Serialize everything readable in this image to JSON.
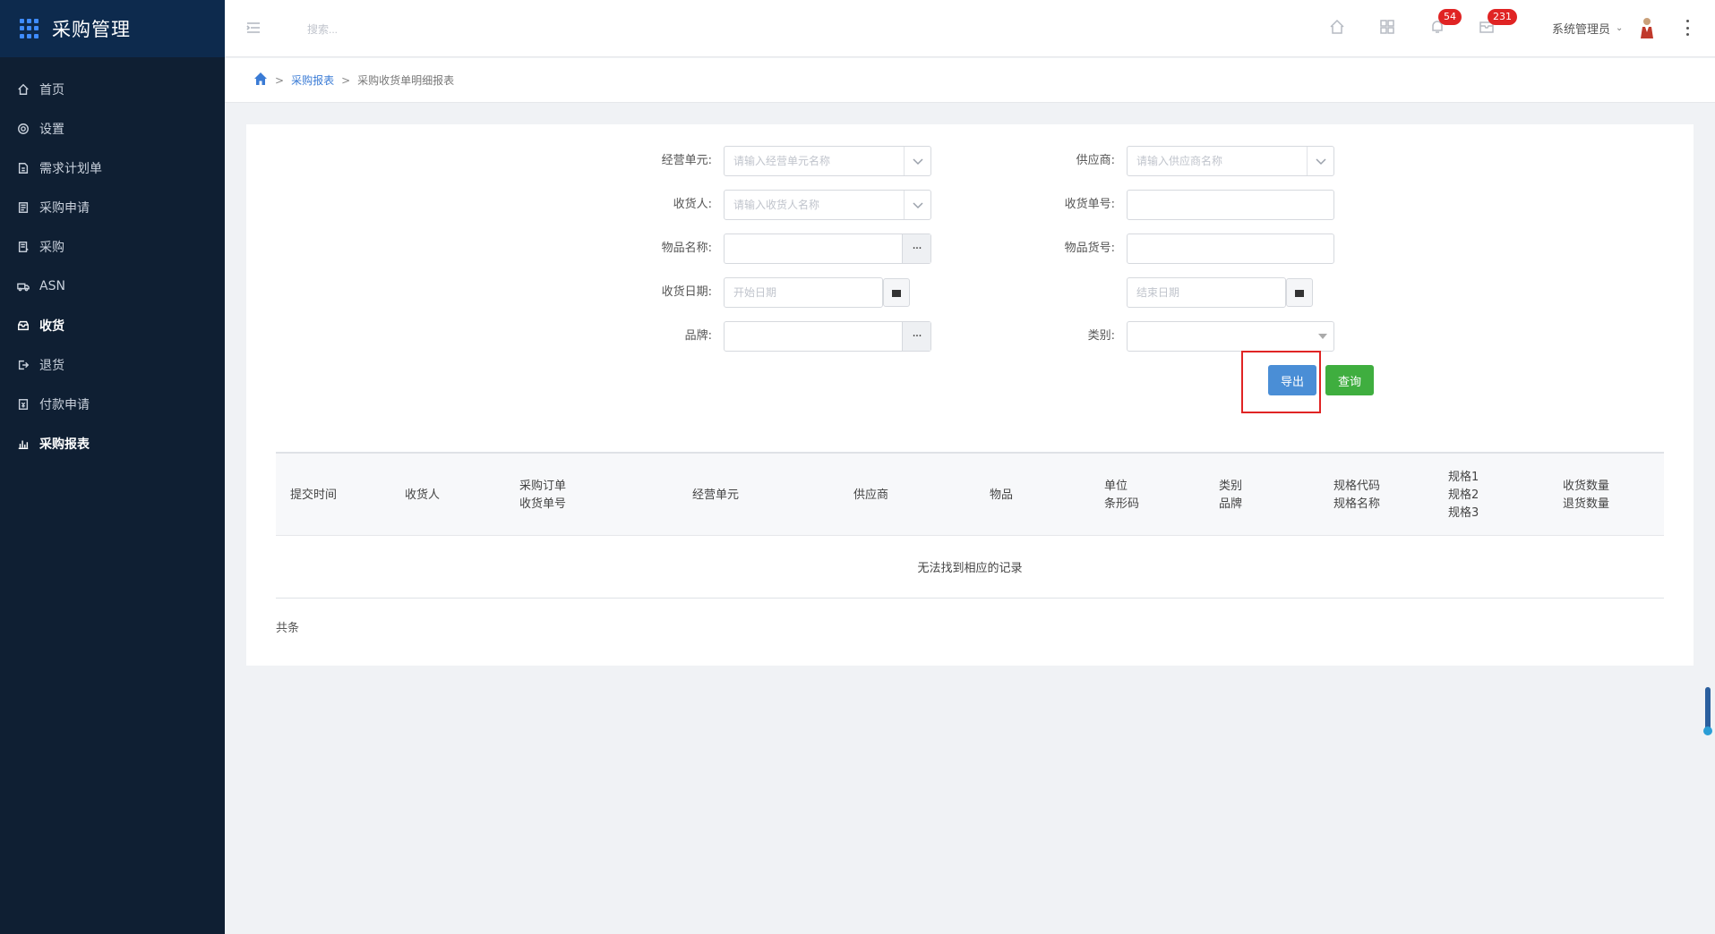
{
  "app": {
    "title": "采购管理"
  },
  "sidebar": {
    "items": [
      {
        "label": "首页",
        "icon": "home-icon"
      },
      {
        "label": "设置",
        "icon": "gear-icon"
      },
      {
        "label": "需求计划单",
        "icon": "document-icon"
      },
      {
        "label": "采购申请",
        "icon": "form-icon"
      },
      {
        "label": "采购",
        "icon": "list-icon"
      },
      {
        "label": "ASN",
        "icon": "truck-icon"
      },
      {
        "label": "收货",
        "icon": "inbox-icon"
      },
      {
        "label": "退货",
        "icon": "return-icon"
      },
      {
        "label": "付款申请",
        "icon": "payment-icon"
      },
      {
        "label": "采购报表",
        "icon": "bar-chart-icon",
        "active": true
      }
    ]
  },
  "topbar": {
    "search_placeholder": "搜索...",
    "notifications_count": "54",
    "messages_count": "231",
    "user_name": "系统管理员"
  },
  "breadcrumb": {
    "parent": "采购报表",
    "current": "采购收货单明细报表"
  },
  "form": {
    "business_unit": {
      "label": "经营单元:",
      "placeholder": "请输入经营单元名称",
      "value": ""
    },
    "supplier": {
      "label": "供应商:",
      "placeholder": "请输入供应商名称",
      "value": ""
    },
    "receiver": {
      "label": "收货人:",
      "placeholder": "请输入收货人名称",
      "value": ""
    },
    "receipt_no": {
      "label": "收货单号:",
      "value": ""
    },
    "item_name": {
      "label": "物品名称:",
      "value": ""
    },
    "item_code": {
      "label": "物品货号:",
      "value": ""
    },
    "receipt_date": {
      "label": "收货日期:",
      "start_placeholder": "开始日期",
      "end_placeholder": "结束日期"
    },
    "brand": {
      "label": "品牌:",
      "value": ""
    },
    "category": {
      "label": "类别:",
      "value": ""
    },
    "export_label": "导出",
    "query_label": "查询"
  },
  "table": {
    "headers": [
      {
        "lines": [
          "提交时间"
        ]
      },
      {
        "lines": [
          "收货人"
        ]
      },
      {
        "lines": [
          "采购订单",
          "收货单号"
        ]
      },
      {
        "lines": [
          "经营单元"
        ]
      },
      {
        "lines": [
          "供应商"
        ]
      },
      {
        "lines": [
          "物品"
        ]
      },
      {
        "lines": [
          "单位",
          "条形码"
        ]
      },
      {
        "lines": [
          "类别",
          "品牌"
        ]
      },
      {
        "lines": [
          "规格代码",
          "规格名称"
        ]
      },
      {
        "lines": [
          "规格1",
          "规格2",
          "规格3"
        ]
      },
      {
        "lines": [
          "收货数量",
          "退货数量"
        ]
      }
    ],
    "empty_text": "无法找到相应的记录",
    "total_text": "共条"
  },
  "colors": {
    "sidebar_bg": "#0f1f33",
    "brand_bg": "#0d2a4d",
    "export_button": "#4a8ed6",
    "query_button": "#3fae3f",
    "badge": "#e02424",
    "highlight_box": "#e02424"
  }
}
